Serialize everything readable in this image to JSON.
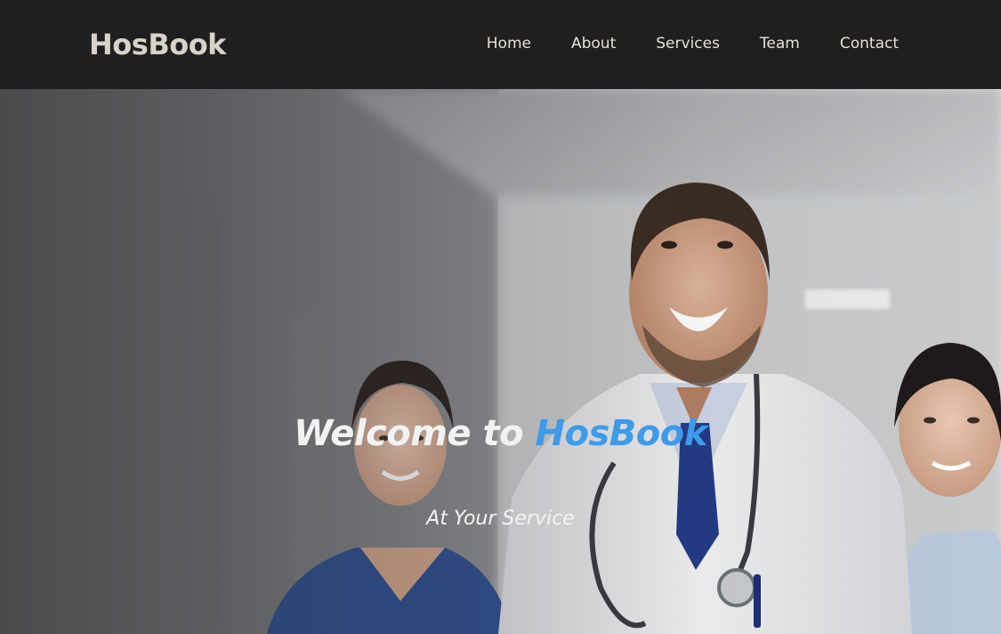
{
  "brand": "HosBook",
  "nav": {
    "items": [
      {
        "label": "Home"
      },
      {
        "label": "About"
      },
      {
        "label": "Services"
      },
      {
        "label": "Team"
      },
      {
        "label": "Contact"
      }
    ]
  },
  "hero": {
    "title_prefix": "Welcome to ",
    "title_accent": "HosBook",
    "subtitle": "At Your Service"
  },
  "colors": {
    "navbar_bg": "#1f1f20",
    "brand_text": "#d9d2c8",
    "accent": "#3d9be9",
    "hero_text": "#f2f2f2"
  }
}
